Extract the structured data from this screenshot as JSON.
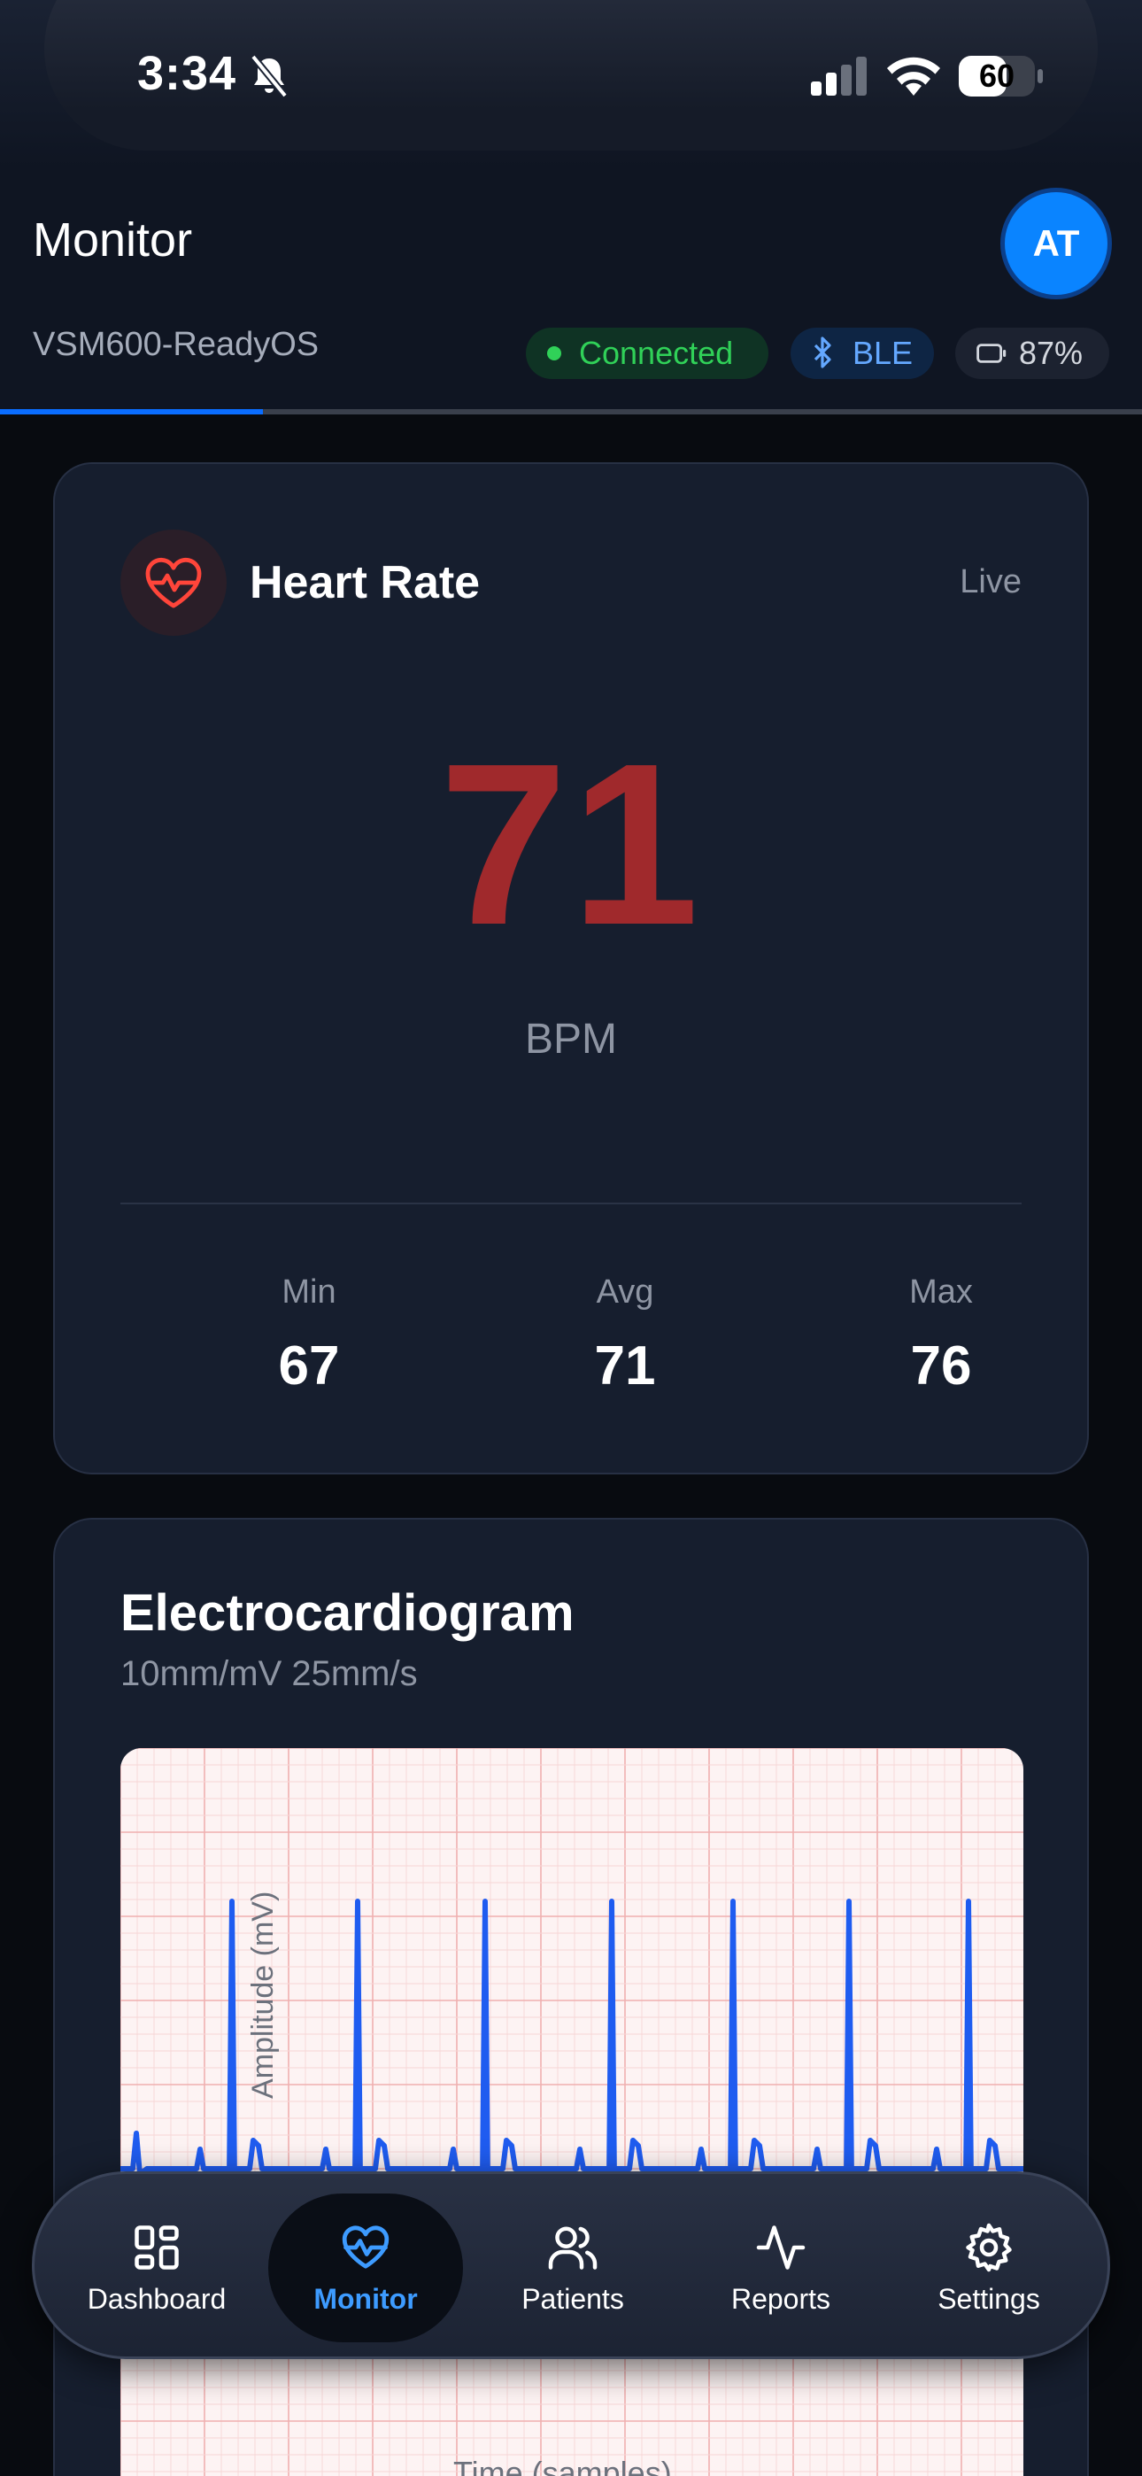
{
  "status_bar": {
    "time": "3:34",
    "battery": "60"
  },
  "header": {
    "title": "Monitor",
    "avatar_initials": "AT",
    "device_name": "VSM600-ReadyOS",
    "connection_status": "Connected",
    "transport": "BLE",
    "device_battery": "87%",
    "progress_fraction": 0.23
  },
  "heart_rate": {
    "title": "Heart Rate",
    "mode": "Live",
    "value": "71",
    "unit": "BPM",
    "stats": [
      {
        "label": "Min",
        "value": "67"
      },
      {
        "label": "Avg",
        "value": "71"
      },
      {
        "label": "Max",
        "value": "76"
      }
    ]
  },
  "ecg": {
    "title": "Electrocardiogram",
    "subtitle": "10mm/mV 25mm/s",
    "y_axis_label": "Amplitude (mV)",
    "x_axis_label": "Time (samples)"
  },
  "tabs": [
    {
      "label": "Dashboard",
      "icon": "grid-icon"
    },
    {
      "label": "Monitor",
      "icon": "heart-pulse-icon",
      "active": true
    },
    {
      "label": "Patients",
      "icon": "users-icon"
    },
    {
      "label": "Reports",
      "icon": "activity-icon"
    },
    {
      "label": "Settings",
      "icon": "gear-icon"
    }
  ],
  "colors": {
    "accent": "#0a84ff",
    "heart_rate": "#a0292c",
    "connected": "#30d158",
    "ecg_trace": "#1f5cf0"
  }
}
